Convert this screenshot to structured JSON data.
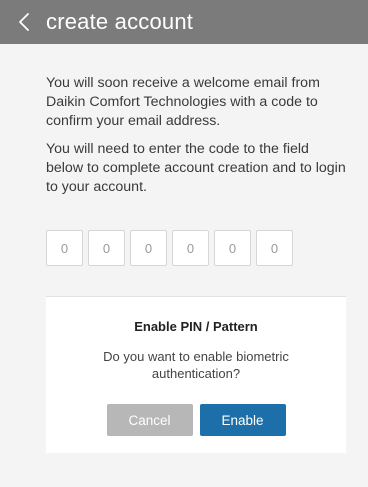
{
  "header": {
    "title": "create account",
    "back_icon": "chevron-left-icon"
  },
  "content": {
    "paragraph_1": "You will soon receive a welcome  email from Daikin Comfort Technologies with a code to confirm your email address.",
    "paragraph_2": "You will need to enter the code to the field below to complete account creation and to login to your account."
  },
  "code_inputs": [
    {
      "placeholder": "0",
      "value": ""
    },
    {
      "placeholder": "0",
      "value": ""
    },
    {
      "placeholder": "0",
      "value": ""
    },
    {
      "placeholder": "0",
      "value": ""
    },
    {
      "placeholder": "0",
      "value": ""
    },
    {
      "placeholder": "0",
      "value": ""
    }
  ],
  "dialog": {
    "title": "Enable PIN / Pattern",
    "message": "Do you want to enable biometric authentication?",
    "cancel_label": "Cancel",
    "enable_label": "Enable"
  },
  "colors": {
    "header_bg": "#7b7b7b",
    "page_bg": "#f4f4f4",
    "cancel_bg": "#b7b7b7",
    "enable_bg": "#1c6fa8"
  }
}
